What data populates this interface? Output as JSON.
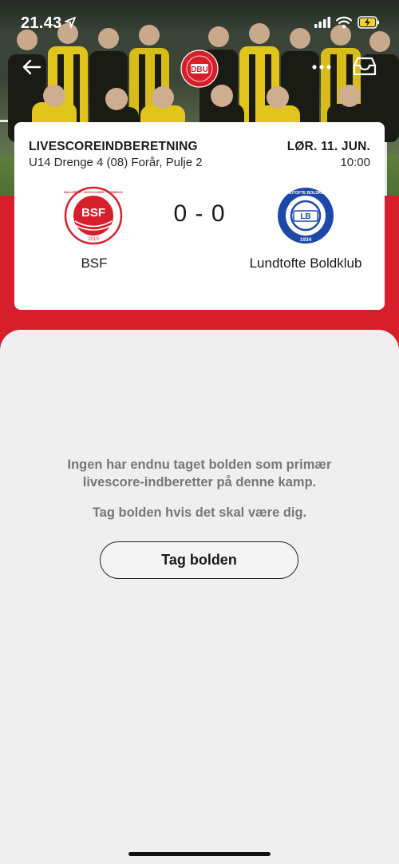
{
  "status_bar": {
    "time": "21.43",
    "icons": [
      "location-arrow-icon",
      "cellular-signal-icon",
      "wifi-icon",
      "battery-charging-icon"
    ]
  },
  "nav": {
    "back_icon": "arrow-left-icon",
    "logo_text": "DBU",
    "more_icon": "more-dots-icon",
    "inbox_icon": "inbox-tray-icon"
  },
  "match": {
    "title": "LIVESCOREINDBERETNING",
    "subtitle": "U14 Drenge 4 (08) Forår, Pulje 2",
    "date": "LØR. 11. JUN.",
    "time": "10:00",
    "score": "0 - 0",
    "home": {
      "name": "BSF",
      "logo_text": "BSF",
      "logo_ring_text": "BALLERUP · SKOVLUNDE · FODBOLD",
      "logo_year": "2010",
      "color": "#d71f2b"
    },
    "away": {
      "name": "Lundtofte Boldklub",
      "logo_text": "LB",
      "logo_ring_text": "LUNDTOFTE BOLDKLUB",
      "logo_year": "1934",
      "color": "#1c48a8"
    }
  },
  "sheet": {
    "message_line1": "Ingen har endnu taget bolden som primær",
    "message_line2": "livescore-indberetter på denne kamp.",
    "message_prompt": "Tag bolden hvis det skal være dig.",
    "button_label": "Tag bolden"
  },
  "colors": {
    "brand_red": "#d71f2b",
    "background": "#efefef",
    "card": "#ffffff",
    "muted_text": "#777777"
  }
}
